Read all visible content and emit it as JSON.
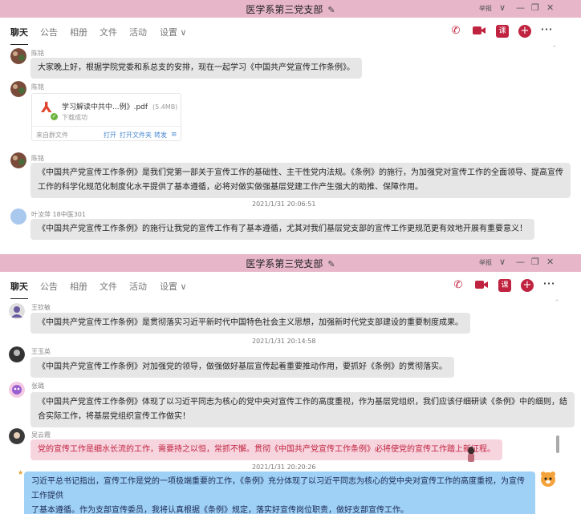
{
  "app": {
    "title": "医学系第三党支部",
    "report_label": "举报",
    "tabs": [
      "聊天",
      "公告",
      "相册",
      "文件",
      "活动",
      "设置 ∨"
    ],
    "icons": [
      "phone-icon",
      "video-icon",
      "course-icon",
      "add-icon",
      "more-icon"
    ],
    "course_glyph": "课",
    "accent": "#c0233f",
    "titlebar_color": "#e7b6c8"
  },
  "window1": {
    "messages": [
      {
        "sender": "陈铭",
        "text": "大家晚上好，根据学院党委和系总支的安排，现在一起学习《中国共产党宣传工作条例》。"
      },
      {
        "sender": "陈铭",
        "file": {
          "name": "学习解读中共中...例》.pdf",
          "size": "(5.4MB)",
          "status": "下载成功",
          "source": "来自群文件",
          "actions": [
            "打开",
            "打开文件夹",
            "转发"
          ]
        }
      },
      {
        "sender": "陈铭",
        "lines": [
          "《中国共产党宣传工作条例》是我们党第一部关于宣传工作的基础性、主干性党内法规。《条例》的施行，为加强党对宣传工作的全面领导、提高宣传",
          "工作的科学化规范化制度化水平提供了基本遵循，必将对做实做强基层党建工作产生强大的助推、保障作用。"
        ]
      },
      {
        "timestamp": "2021/1/31 20:06:51"
      },
      {
        "sender": "叶汝萍 18中医301",
        "text": "《中国共产党宣传工作条例》的施行让我党的宣传工作有了基本遵循，尤其对我们基层党支部的宣传工作更规范更有效地开展有重要意义！"
      }
    ]
  },
  "window2": {
    "messages": [
      {
        "sender": "王钦敏",
        "text": "《中国共产党宣传工作条例》是贯彻落实习近平新时代中国特色社会主义思想，加强新时代党支部建设的重要制度成果。"
      },
      {
        "timestamp": "2021/1/31 20:14:58"
      },
      {
        "sender": "王玉英",
        "text": "《中国共产党宣传工作条例》对加强党的领导，做强做好基层宣传起着重要推动作用，要抓好《条例》的贯彻落实。"
      },
      {
        "sender": "张璐",
        "lines": [
          "《中国共产党宣传工作条例》体现了以习近平同志为核心的党中央对宣传工作的高度重视，作为基层党组织，我们应该仔细研读《条例》中的细则，结",
          "合实际工作，将基层党组织宣传工作做实！"
        ]
      },
      {
        "sender": "吴云霞",
        "text": "党的宣传工作是细水长流的工作，需要持之以恒，常抓不懈。贯彻《中国共产党宣传工作条例》必将使党的宣传工作踏上新征程。",
        "style": "pink"
      },
      {
        "timestamp": "2021/1/31 20:20:26"
      },
      {
        "lines": [
          "习近平总书记指出，宣传工作是党的一项极端重要的工作，《条例》充分体现了以习近平同志为核心的党中央对宣传工作的高度重视，为宣传工作提供",
          "了基本遵循。作为支部宣传委员，我将认真根据《条例》规定，落实好宣传岗位职责，做好支部宣传工作。"
        ],
        "style": "blue"
      }
    ]
  }
}
